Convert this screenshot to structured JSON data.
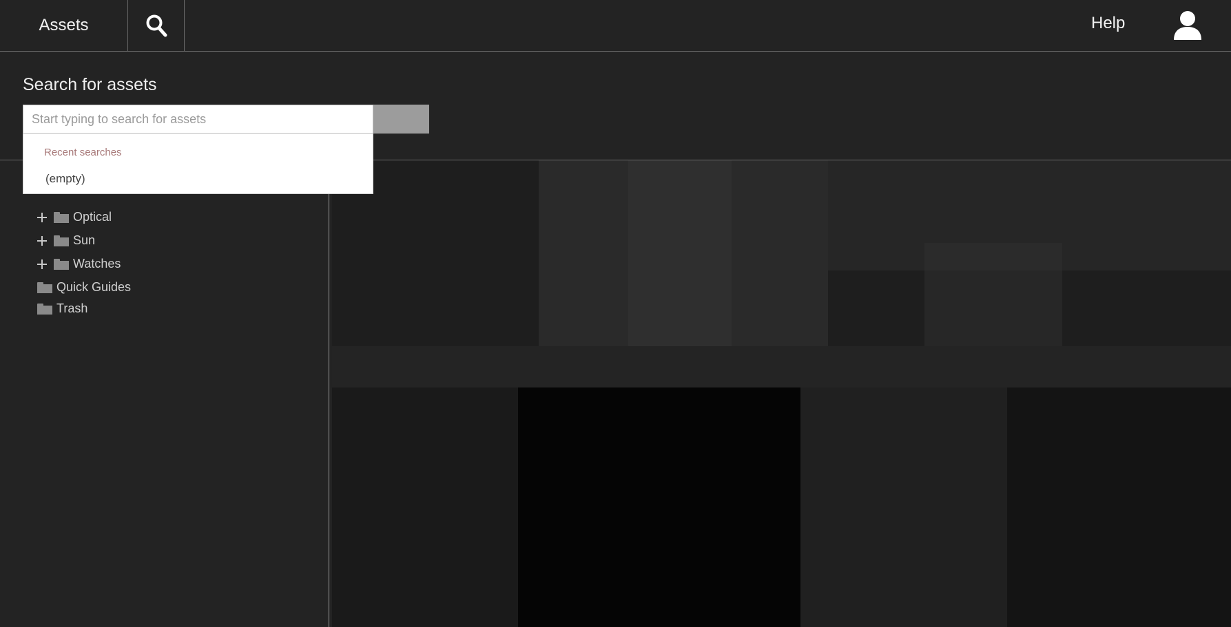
{
  "header": {
    "brand": "Assets",
    "help_label": "Help"
  },
  "search": {
    "title": "Search for assets",
    "placeholder": "Start typing to search for assets",
    "value": ""
  },
  "dropdown": {
    "heading": "Recent searches",
    "items": [
      "(empty)"
    ]
  },
  "tree": {
    "items": [
      {
        "label": "Optical",
        "expandable": true
      },
      {
        "label": "Sun",
        "expandable": true
      },
      {
        "label": "Watches",
        "expandable": true
      },
      {
        "label": "Quick Guides",
        "expandable": false
      },
      {
        "label": "Trash",
        "expandable": false
      }
    ]
  },
  "colors": {
    "background": "#232323",
    "divider": "#6a6a6a",
    "submit": "#9c9c9c",
    "recent_heading": "#a87a7a"
  },
  "icons": {
    "search": "magnifier-icon",
    "user": "user-icon",
    "expand": "plus-icon",
    "folder": "folder-icon"
  }
}
